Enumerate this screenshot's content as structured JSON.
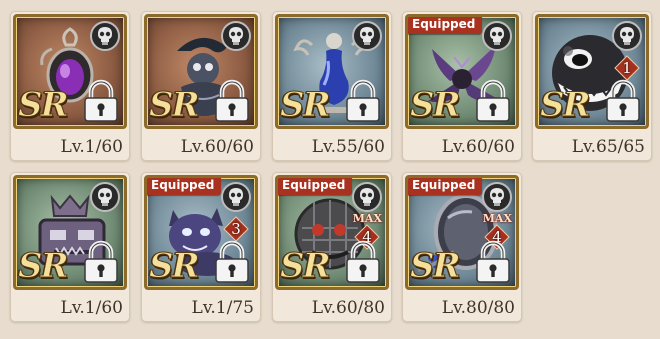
{
  "items": [
    {
      "level": "Lv.1/60",
      "equipped": false,
      "rarity": "SR",
      "theme": "brown",
      "art": "amulet-icon",
      "locked": true,
      "rank": null,
      "max": false
    },
    {
      "level": "Lv.60/60",
      "equipped": false,
      "rarity": "SR",
      "theme": "brown",
      "art": "dark-statue-icon",
      "locked": true,
      "rank": null,
      "max": false
    },
    {
      "level": "Lv.55/60",
      "equipped": false,
      "rarity": "SR",
      "theme": "blue",
      "art": "blue-vase-icon",
      "locked": true,
      "rank": null,
      "max": false
    },
    {
      "level": "Lv.60/60",
      "equipped": true,
      "rarity": "SR",
      "theme": "green",
      "art": "dark-wings-icon",
      "locked": true,
      "rank": null,
      "max": false
    },
    {
      "level": "Lv.65/65",
      "equipped": false,
      "rarity": "SR",
      "theme": "blue",
      "art": "chomp-ball-icon",
      "locked": true,
      "rank": "1",
      "max": false
    },
    {
      "level": "Lv.1/60",
      "equipped": false,
      "rarity": "SR",
      "theme": "green",
      "art": "crown-crate-icon",
      "locked": true,
      "rank": null,
      "max": false
    },
    {
      "level": "Lv.1/75",
      "equipped": true,
      "rarity": "SR",
      "theme": "blue",
      "art": "purple-beast-icon",
      "locked": true,
      "rank": "3",
      "max": false
    },
    {
      "level": "Lv.60/80",
      "equipped": true,
      "rarity": "SR",
      "theme": "green",
      "art": "iron-mask-icon",
      "locked": true,
      "rank": "4",
      "max": true
    },
    {
      "level": "Lv.80/80",
      "equipped": true,
      "rarity": "SR",
      "theme": "blue",
      "art": "mirror-icon",
      "locked": true,
      "rank": "4",
      "max": true
    }
  ],
  "labels": {
    "equipped": "Equipped",
    "max": "MAX"
  },
  "colors": {
    "equipped_bg": "#a8321f",
    "sr_text": "#f4e09a",
    "rank_bg": "#a3311e",
    "frame_gold": "#8c6a2a"
  }
}
